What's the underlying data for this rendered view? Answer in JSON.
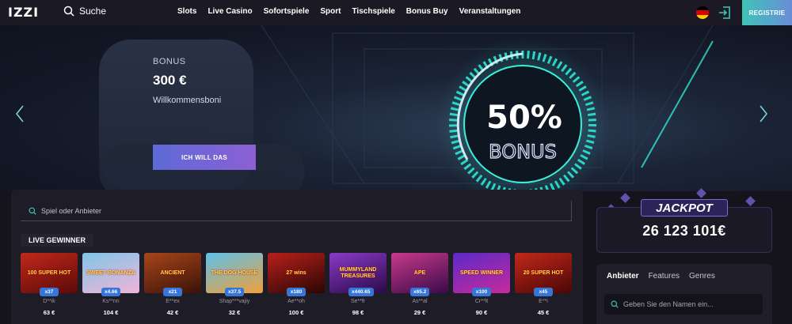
{
  "header": {
    "logo": "IZZI",
    "search_label": "Suche",
    "nav": [
      "Slots",
      "Live Casino",
      "Sofortspiele",
      "Sport",
      "Tischspiele",
      "Bonus Buy",
      "Veranstaltungen"
    ],
    "register_label": "REGISTRIE",
    "language_flag": "germany-flag-icon"
  },
  "hero": {
    "bonus_label": "BONUS",
    "amount": "300 €",
    "subtitle": "Willkommensboni",
    "cta_label": "ICH WILL DAS",
    "image_text_percent": "50%",
    "image_text_bonus": "BONUS"
  },
  "games": {
    "search_placeholder": "Spiel oder Anbieter",
    "live_winners_title": "LIVE GEWINNER",
    "winners": [
      {
        "game": "100 SUPER HOT",
        "multiplier": "x37",
        "user": "D**ik",
        "amount": "63 €",
        "color1": "#c2281b",
        "color2": "#5a0a08"
      },
      {
        "game": "SWEET BONANZA",
        "multiplier": "x4.66",
        "user": "Ks**nn",
        "amount": "104 €",
        "color1": "#f2b4d8",
        "color2": "#7ec6e8"
      },
      {
        "game": "ANCIENT",
        "multiplier": "x21",
        "user": "E**ex",
        "amount": "42 €",
        "color1": "#a8461a",
        "color2": "#3a1208"
      },
      {
        "game": "THE DOG HOUSE",
        "multiplier": "x37.5",
        "user": "Shap***vajiy",
        "amount": "32 €",
        "color1": "#5ec0ea",
        "color2": "#f0a03a"
      },
      {
        "game": "27 wins",
        "multiplier": "x180",
        "user": "Ae**oh",
        "amount": "100 €",
        "color1": "#b8201a",
        "color2": "#2a0604"
      },
      {
        "game": "MUMMYLAND TREASURES",
        "multiplier": "x440.65",
        "user": "Se**fr",
        "amount": "98 €",
        "color1": "#8a3ac8",
        "color2": "#2a0a48"
      },
      {
        "game": "APE",
        "multiplier": "x65.2",
        "user": "As**al",
        "amount": "29 €",
        "color1": "#c83a8a",
        "color2": "#3a0a4a"
      },
      {
        "game": "SPEED WINNER",
        "multiplier": "x100",
        "user": "Cr**lt",
        "amount": "90 €",
        "color1": "#5a2ac8",
        "color2": "#c82a9a"
      },
      {
        "game": "20 SUPER HOT",
        "multiplier": "x45",
        "user": "E**i",
        "amount": "45 €",
        "color1": "#c2281b",
        "color2": "#4a0606"
      }
    ]
  },
  "jackpot": {
    "title": "JACKPOT",
    "amount": "26 123 101€"
  },
  "side": {
    "tabs": [
      "Anbieter",
      "Features",
      "Genres"
    ],
    "search_placeholder": "Geben Sie den Namen ein..."
  },
  "colors": {
    "accent": "#6d5cc8",
    "register_gradient_start": "#3fc4b8",
    "multiplier_badge": "#3776d9",
    "neon": "#3af0d8"
  }
}
